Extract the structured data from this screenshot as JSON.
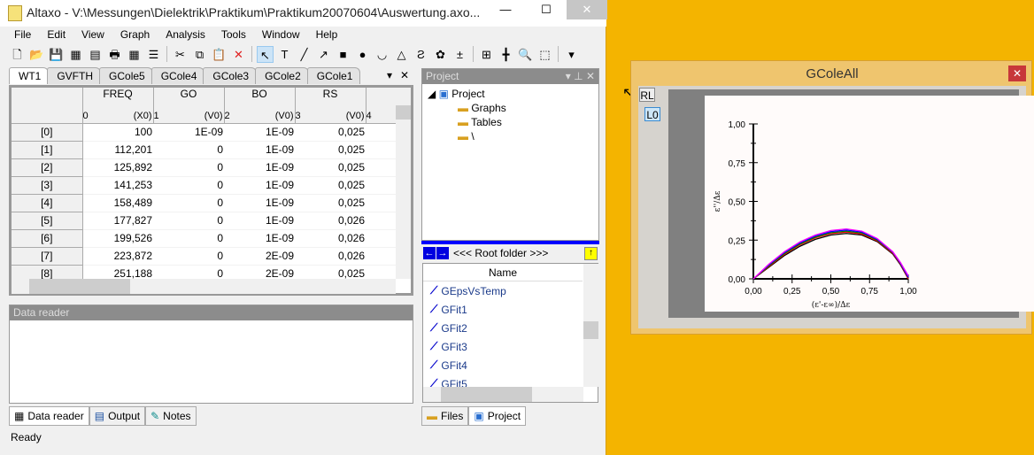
{
  "window": {
    "title": "Altaxo - V:\\Messungen\\Dielektrik\\Praktikum\\Praktikum20070604\\Auswertung.axo...",
    "minimize": "—",
    "maximize": "☐",
    "close": "✕"
  },
  "menu": [
    "File",
    "Edit",
    "View",
    "Graph",
    "Analysis",
    "Tools",
    "Window",
    "Help"
  ],
  "toolbar": {
    "icons": [
      "new-icon",
      "open-icon",
      "save-icon",
      "new-worksheet-icon",
      "new-layout-icon",
      "print-icon",
      "calculator-icon",
      "layers-icon",
      "cut-icon",
      "copy-icon",
      "paste-icon",
      "delete-icon",
      "pointer-icon",
      "text-icon",
      "line-icon",
      "arrow-icon",
      "rectangle-icon",
      "ellipse-icon",
      "curly-icon",
      "triangle-icon",
      "curve-icon",
      "shape-icon",
      "plot-style-icon",
      "zoom-region-icon",
      "cross-icon",
      "zoom-icon",
      "axis-icon",
      "dropdown-icon"
    ],
    "glyphs": [
      "🗋",
      "📂",
      "💾",
      "▦",
      "▤",
      "🖶",
      "▦",
      "☰",
      "✂",
      "⧉",
      "📋",
      "✕",
      "↖",
      "T",
      "╱",
      "↗",
      "■",
      "●",
      "◡",
      "△",
      "Ƨ",
      "✿",
      "±",
      "⊞",
      "╋",
      "🔍",
      "⬚",
      "▾"
    ]
  },
  "doc_tabs": [
    "WT1",
    "GVFTH",
    "GCole5",
    "GCole4",
    "GCole3",
    "GCole2",
    "GCole1"
  ],
  "doc_tabs_controls": {
    "menu": "▾",
    "close": "✕"
  },
  "table": {
    "columns": [
      {
        "name": "FREQ",
        "index": "0",
        "kind": "(X0)"
      },
      {
        "name": "GO",
        "index": "1",
        "kind": "(V0)"
      },
      {
        "name": "BO",
        "index": "2",
        "kind": "(V0)"
      },
      {
        "name": "RS",
        "index": "3",
        "kind": "(V0)"
      },
      {
        "name": "",
        "index": "4",
        "kind": ""
      }
    ],
    "rows": [
      {
        "label": "[0]",
        "cells": [
          "100",
          "1E-09",
          "1E-09",
          "0,025"
        ]
      },
      {
        "label": "[1]",
        "cells": [
          "112,201",
          "0",
          "1E-09",
          "0,025"
        ]
      },
      {
        "label": "[2]",
        "cells": [
          "125,892",
          "0",
          "1E-09",
          "0,025"
        ]
      },
      {
        "label": "[3]",
        "cells": [
          "141,253",
          "0",
          "1E-09",
          "0,025"
        ]
      },
      {
        "label": "[4]",
        "cells": [
          "158,489",
          "0",
          "1E-09",
          "0,025"
        ]
      },
      {
        "label": "[5]",
        "cells": [
          "177,827",
          "0",
          "1E-09",
          "0,026"
        ]
      },
      {
        "label": "[6]",
        "cells": [
          "199,526",
          "0",
          "1E-09",
          "0,026"
        ]
      },
      {
        "label": "[7]",
        "cells": [
          "223,872",
          "0",
          "2E-09",
          "0,026"
        ]
      },
      {
        "label": "[8]",
        "cells": [
          "251,188",
          "0",
          "2E-09",
          "0,025"
        ]
      }
    ]
  },
  "data_reader": {
    "title": "Data reader"
  },
  "bottom_tabs": [
    "Data reader",
    "Output",
    "Notes"
  ],
  "status": "Ready",
  "project": {
    "title": "Project",
    "tree": [
      "Project",
      "Graphs",
      "Tables",
      "\\"
    ],
    "nav_label": "<<< Root folder >>>",
    "column": "Name",
    "items": [
      "GEpsVsTemp",
      "GFit1",
      "GFit2",
      "GFit3",
      "GFit4",
      "GFit5"
    ],
    "tabs": [
      "Files",
      "Project"
    ]
  },
  "graph_window": {
    "title": "GColeAll",
    "close": "✕",
    "layer_buttons": [
      "RL",
      "L0"
    ]
  },
  "chart_data": {
    "type": "line",
    "xlabel": "(ε'-ε∞)/Δε",
    "ylabel": "ε''/Δε",
    "xlim": [
      0,
      1
    ],
    "ylim": [
      0,
      1
    ],
    "xticks": [
      "0,00",
      "0,25",
      "0,50",
      "0,75",
      "1,00"
    ],
    "yticks": [
      "0,00",
      "0,25",
      "0,50",
      "0,75",
      "1,00"
    ],
    "grid": false,
    "x": [
      0,
      0.1,
      0.2,
      0.3,
      0.4,
      0.5,
      0.6,
      0.7,
      0.8,
      0.9,
      0.95,
      1.0
    ],
    "series": [
      {
        "color": "#000000",
        "values": [
          0,
          0.075,
          0.15,
          0.21,
          0.255,
          0.283,
          0.293,
          0.283,
          0.24,
          0.16,
          0.09,
          0.0
        ]
      },
      {
        "color": "#ff0000",
        "values": [
          0,
          0.08,
          0.158,
          0.22,
          0.265,
          0.292,
          0.302,
          0.29,
          0.245,
          0.165,
          0.095,
          0.0
        ]
      },
      {
        "color": "#008000",
        "values": [
          0,
          0.085,
          0.163,
          0.225,
          0.27,
          0.298,
          0.308,
          0.296,
          0.25,
          0.17,
          0.1,
          0.01
        ]
      },
      {
        "color": "#0000ff",
        "values": [
          0,
          0.09,
          0.17,
          0.232,
          0.277,
          0.305,
          0.315,
          0.302,
          0.255,
          0.172,
          0.1,
          0.01
        ]
      },
      {
        "color": "#ff00ff",
        "values": [
          0,
          0.095,
          0.175,
          0.238,
          0.283,
          0.312,
          0.322,
          0.308,
          0.26,
          0.175,
          0.105,
          0.02
        ]
      }
    ]
  }
}
